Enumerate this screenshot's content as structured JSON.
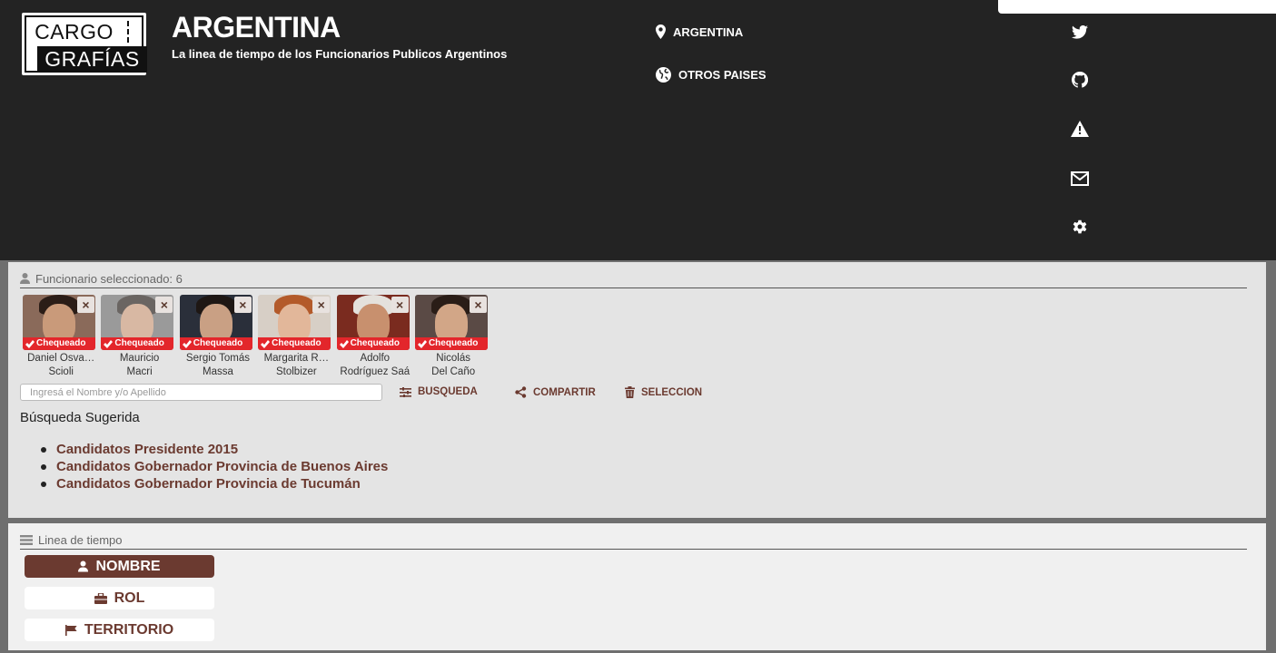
{
  "header": {
    "logo_top": "CARGO",
    "logo_bottom": "GRAFÍAS",
    "title": "ARGENTINA",
    "subtitle": "La linea de tiempo de los Funcionarios Publicos Argentinos",
    "nav": [
      {
        "label": "ARGENTINA",
        "icon": "map-marker-icon"
      },
      {
        "label": "OTROS PAISES",
        "icon": "globe-icon"
      }
    ],
    "side_icons": [
      "twitter-icon",
      "github-icon",
      "warning-icon",
      "envelope-icon",
      "gear-icon"
    ]
  },
  "selection": {
    "heading": "Funcionario seleccionado: 6",
    "badge_label": "Chequeado",
    "close_label": "×",
    "people": [
      {
        "line1": "Daniel Osva…",
        "line2": "Scioli",
        "skin": "#c99a7a",
        "hair": "#2b1d17",
        "bg": "#8a6a5a"
      },
      {
        "line1": "Mauricio",
        "line2": "Macri",
        "skin": "#d8b8a3",
        "hair": "#6a6562",
        "bg": "#9a9a9a"
      },
      {
        "line1": "Sergio Tomás",
        "line2": "Massa",
        "skin": "#c9a084",
        "hair": "#1e1714",
        "bg": "#2a2f3a"
      },
      {
        "line1": "Margarita R…",
        "line2": "Stolbizer",
        "skin": "#e2b79a",
        "hair": "#b35a2a",
        "bg": "#d7cfc6"
      },
      {
        "line1": "Adolfo",
        "line2": "Rodríguez Saá",
        "skin": "#c8906e",
        "hair": "#e4e1dc",
        "bg": "#7a2b1f"
      },
      {
        "line1": "Nicolás",
        "line2": "Del Caño",
        "skin": "#d2a687",
        "hair": "#2a1d17",
        "bg": "#5a4a45"
      }
    ],
    "search_placeholder": "Ingresá el Nombre y/o Apellido",
    "actions": {
      "busqueda": "BUSQUEDA",
      "compartir": "COMPARTIR",
      "seleccion": "SELECCION"
    },
    "suggested_title": "Búsqueda Sugerida",
    "suggested": [
      "Candidatos Presidente 2015",
      "Candidatos Gobernador Provincia de Buenos Aires",
      "Candidatos Gobernador Provincia de Tucumán"
    ]
  },
  "timeline": {
    "heading": "Linea de tiempo",
    "buttons": {
      "nombre": "NOMBRE",
      "rol": "ROL",
      "territorio": "TERRITORIO"
    }
  },
  "colors": {
    "accent": "#6b3a30",
    "header_bg": "#232323",
    "badge_red": "#e3262b",
    "panel_bg": "#e4e4e4"
  }
}
